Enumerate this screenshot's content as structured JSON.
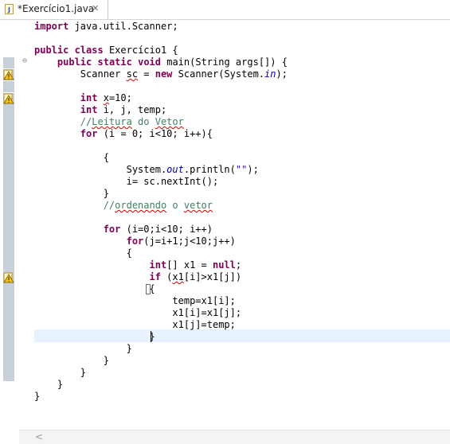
{
  "tab": {
    "title": "*Exercício1.java",
    "close_glyph": "✕"
  },
  "colors": {
    "keyword": "#7f0055",
    "comment": "#3f7f5f",
    "field": "#0000c0",
    "string": "#2a00ff",
    "current_line": "#e8f2fe"
  },
  "code": {
    "l1": {
      "kw": "import",
      "rest": " java.util.Scanner;"
    },
    "l3": {
      "kw1": "public",
      "kw2": "class",
      "rest": " Exercício1 {"
    },
    "l4": {
      "indent": "    ",
      "kw1": "public",
      "kw2": "static",
      "kw3": "void",
      "rest": " main(String args[]) {"
    },
    "l5": {
      "a": "        Scanner ",
      "v": "sc",
      "b": " = ",
      "kw": "new",
      "c": " Scanner(System.",
      "f": "in",
      "d": ");"
    },
    "l7": {
      "indent": "        ",
      "kw": "int",
      "sp": " ",
      "v": "x",
      "rest": "=10;"
    },
    "l8": {
      "indent": "        ",
      "kw": "int",
      "rest": " i, j, temp;"
    },
    "l9": {
      "indent": "        ",
      "a": "//",
      "b": "Leitura",
      "c": " do ",
      "d": "Vetor"
    },
    "l10": {
      "indent": "        ",
      "kw": "for",
      "rest": " (i = 0; i<10; i++){"
    },
    "l12": {
      "text": "            {"
    },
    "l13": {
      "a": "                System.",
      "f": "out",
      "b": ".println(",
      "s": "\"\"",
      "c": ");"
    },
    "l14": {
      "text": "                i= sc.nextInt();"
    },
    "l15": {
      "text": "            }"
    },
    "l16": {
      "indent": "            ",
      "a": "//",
      "b": "ordenando",
      "c": " o ",
      "d": "vetor"
    },
    "l18": {
      "indent": "            ",
      "kw": "for",
      "rest": " (i=0;i<10; i++)"
    },
    "l19": {
      "indent": "                ",
      "kw": "for",
      "rest": "(j=i+1;j<10;j++)"
    },
    "l20": {
      "text": "                {"
    },
    "l21": {
      "indent": "                    ",
      "kw": "int",
      "a": "[] x1 = ",
      "kw2": "null",
      "b": ";"
    },
    "l22": {
      "indent": "                    ",
      "kw": "if",
      "a": " (",
      "v": "x1",
      "b": "[i]>x1[j])"
    },
    "l23": {
      "indent": "                    ",
      "brace": "{"
    },
    "l24": {
      "text": "                        temp=x1[i];"
    },
    "l25": {
      "text": "                        x1[i]=x1[j];"
    },
    "l26": {
      "text": "                        x1[j]=temp;"
    },
    "l27": {
      "indent": "                    ",
      "brace": "}"
    },
    "l28": {
      "text": "                }"
    },
    "l29": {
      "text": "            }"
    },
    "l30": {
      "text": "        }"
    },
    "l31": {
      "text": "    }"
    },
    "l32": {
      "text": "}"
    }
  },
  "fold_glyph": "⊖",
  "scroll_left_glyph": "<"
}
